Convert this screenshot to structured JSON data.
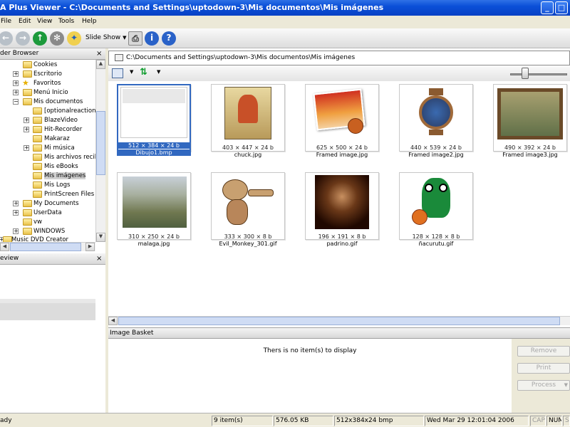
{
  "window": {
    "title": "A Plus Viewer - C:\\Documents and Settings\\uptodown-3\\Mis documentos\\Mis imágenes"
  },
  "menu": [
    {
      "label": "File"
    },
    {
      "label": "Edit"
    },
    {
      "label": "View"
    },
    {
      "label": "Tools"
    },
    {
      "label": "Help"
    }
  ],
  "toolbar": {
    "slideshow_label": "Slide Show"
  },
  "folder_browser": {
    "title": "der Browser",
    "items": [
      {
        "label": "Cookies"
      },
      {
        "label": "Escritorio"
      },
      {
        "label": "Favoritos"
      },
      {
        "label": "Menú Inicio"
      },
      {
        "label": "Mis documentos"
      },
      {
        "label": "[optionalreaction]a"
      },
      {
        "label": "BlazeVideo"
      },
      {
        "label": "Hit-Recorder"
      },
      {
        "label": "Makaraz"
      },
      {
        "label": "Mi música"
      },
      {
        "label": "Mis archivos recibi"
      },
      {
        "label": "Mis eBooks"
      },
      {
        "label": "Mis imágenes"
      },
      {
        "label": "Mis Logs"
      },
      {
        "label": "PrintScreen Files"
      },
      {
        "label": "My Documents"
      },
      {
        "label": "UserData"
      },
      {
        "label": "vw"
      },
      {
        "label": "WINDOWS"
      },
      {
        "label": "Music DVD Creator"
      }
    ]
  },
  "preview": {
    "title": "eview"
  },
  "path_bar": {
    "path": "C:\\Documents and Settings\\uptodown-3\\Mis documentos\\Mis imágenes"
  },
  "thumbnails": [
    {
      "info": "512 × 384 × 24 b",
      "name": "Dibujo1.bmp",
      "selected": true
    },
    {
      "info": "403 × 447 × 24 b",
      "name": "chuck.jpg"
    },
    {
      "info": "625 × 500 × 24 b",
      "name": "Framed image.jpg"
    },
    {
      "info": "440 × 539 × 24 b",
      "name": "Framed image2.jpg"
    },
    {
      "info": "490 × 392 × 24 b",
      "name": "Framed image3.jpg"
    },
    {
      "info": "310 × 250 × 24 b",
      "name": "malaga.jpg"
    },
    {
      "info": "333 × 300 × 8 b",
      "name": "Evil_Monkey_301.gif"
    },
    {
      "info": "196 × 191 × 8 b",
      "name": "padrino.gif"
    },
    {
      "info": "128 × 128 × 8 b",
      "name": "ñacurutu.gif"
    }
  ],
  "basket": {
    "title": "Image Basket",
    "empty_message": "Thers is no item(s) to display",
    "remove_label": "Remove",
    "print_label": "Print",
    "process_label": "Process"
  },
  "status": {
    "ready": "ady",
    "items": "9 item(s)",
    "size": "576.05 KB",
    "dims": "512x384x24 bmp",
    "datetime": "Wed Mar 29 12:01:04 2006",
    "caps": "CAP",
    "num": "NUM",
    "scrl": "SC"
  },
  "colors": {
    "title_bar": "#0a4fd8",
    "selection": "#3168c0",
    "chrome": "#ece9d8"
  }
}
